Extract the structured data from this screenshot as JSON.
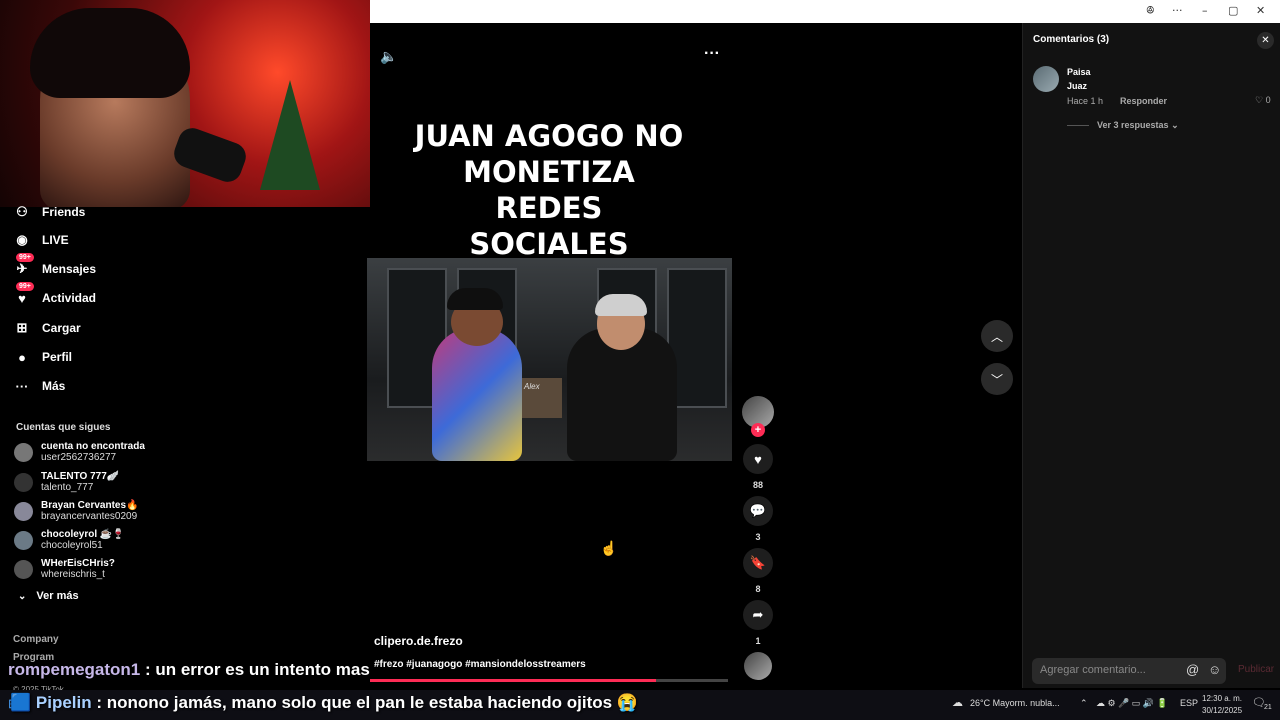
{
  "window_controls": [
    "ꔮ",
    "···",
    "–",
    "▢",
    "✕"
  ],
  "nav": {
    "items": [
      {
        "label": "Friends",
        "icon": "friends-icon",
        "glyph": "⚇"
      },
      {
        "label": "LIVE",
        "icon": "live-icon",
        "glyph": "◉"
      },
      {
        "label": "Mensajes",
        "icon": "messages-icon",
        "glyph": "✈",
        "badge": "99+"
      },
      {
        "label": "Actividad",
        "icon": "activity-icon",
        "glyph": "♥",
        "badge": "99+"
      },
      {
        "label": "Cargar",
        "icon": "upload-icon",
        "glyph": "⊞"
      },
      {
        "label": "Perfil",
        "icon": "profile-icon",
        "glyph": "●"
      },
      {
        "label": "Más",
        "icon": "more-icon",
        "glyph": "···"
      }
    ]
  },
  "following": {
    "title": "Cuentas que sigues",
    "accounts": [
      {
        "name": "cuenta no encontrada",
        "handle": "user2562736277"
      },
      {
        "name": "TALENTO 777🪽",
        "handle": "talento_777"
      },
      {
        "name": "Brayan Cervantes🔥",
        "handle": "brayancervantes0209"
      },
      {
        "name": "chocoleyrol ☕🍷",
        "handle": "chocoleyrol51"
      },
      {
        "name": "WHerEisCHris?",
        "handle": "whereischris_t"
      }
    ],
    "see_more": "Ver más"
  },
  "footer": {
    "company": "Company",
    "program": "Program",
    "copyright": "© 2025 TikTok"
  },
  "video": {
    "title_lines": [
      "JUAN AGOGO NO",
      "MONETIZA REDES",
      "SOCIALES"
    ],
    "username": "clipero.de.frezo",
    "hashtags": "#frezo #juanagogo #mansiondelosstreamers",
    "progress": 0.8,
    "clip_sign": "Alex"
  },
  "actions": {
    "likes": "88",
    "comments": "3",
    "saves": "8",
    "shares": "1"
  },
  "comments_panel": {
    "header": "Comentarios (3)",
    "comment": {
      "user": "Paisa",
      "text": "Juaz",
      "time": "Hace 1 h",
      "reply": "Responder",
      "likes": "0",
      "more_replies": "Ver 3 respuestas"
    },
    "input_placeholder": "Agregar comentario...",
    "publish": "Publicar"
  },
  "stream_chat": [
    {
      "user": "rompemegaton1",
      "message": " : un error es un intento mas"
    },
    {
      "user": "Pipelin",
      "message": " : nonono jamás, mano solo que el pan le estaba haciendo ojitos 😭"
    }
  ],
  "taskbar": {
    "weather": "26°C  Mayorm. nubla...",
    "lang": "ESP",
    "time": "12:30 a. m.",
    "date": "30/12/2025",
    "notifications": "21"
  }
}
